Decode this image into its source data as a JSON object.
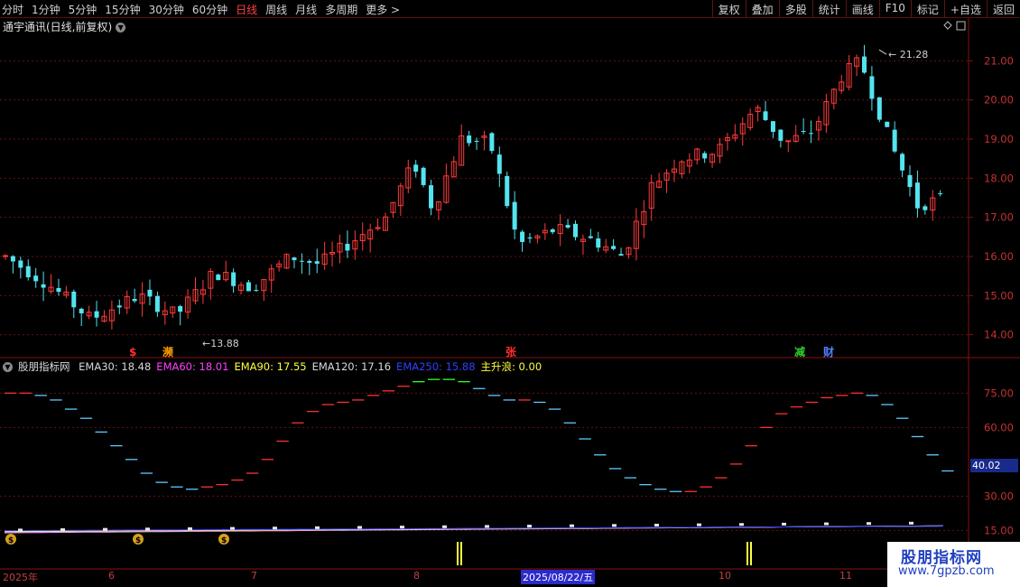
{
  "toolbar": {
    "periods": [
      "分时",
      "1分钟",
      "5分钟",
      "15分钟",
      "30分钟",
      "60分钟",
      "日线",
      "周线",
      "月线",
      "多周期",
      "更多 >"
    ],
    "active_period": "日线",
    "actions": [
      "复权",
      "叠加",
      "多股",
      "统计",
      "画线",
      "F10",
      "标记",
      "+自选",
      "返回"
    ]
  },
  "stock": {
    "title": "通宇通讯(日线,前复权)"
  },
  "price_axis": {
    "ticks": [
      "21.00",
      "20.00",
      "19.00",
      "18.00",
      "17.00",
      "16.00",
      "15.00",
      "14.00"
    ]
  },
  "annotations": {
    "high": "21.28",
    "low": "13.88"
  },
  "badges": [
    {
      "text": "$",
      "color": "#ff3030"
    },
    {
      "text": "濒",
      "color": "#ffa000"
    },
    {
      "text": "张",
      "color": "#ff3030"
    },
    {
      "text": "减",
      "color": "#30d030"
    },
    {
      "text": "财",
      "color": "#5080ff"
    }
  ],
  "indicator": {
    "name": "股朋指标网",
    "items": [
      {
        "label": "EMA30: 18.48",
        "color": "#d8d8d8"
      },
      {
        "label": "EMA60: 18.01",
        "color": "#ff40ff"
      },
      {
        "label": "EMA90: 17.55",
        "color": "#ffff40"
      },
      {
        "label": "EMA120: 17.16",
        "color": "#d8d8d8"
      },
      {
        "label": "EMA250: 15.88",
        "color": "#3040ff"
      },
      {
        "label": "主升浪: 0.00",
        "color": "#ffff40"
      }
    ],
    "axis_ticks": [
      "75.00",
      "60.00",
      "30.00",
      "15.00"
    ],
    "current_value": "40.02"
  },
  "date_axis": {
    "labels": [
      "2025年",
      "6",
      "7",
      "8",
      "10",
      "11"
    ],
    "selected": "2025/08/22/五"
  },
  "watermark": {
    "line1": "股朋指标网",
    "line2": "www.7gpzb.com"
  },
  "chart_data": {
    "type": "candlestick",
    "title": "通宇通讯(日线,前复权)",
    "price_range": [
      13.6,
      21.7
    ],
    "high": 21.28,
    "low": 13.88,
    "indicator_range": [
      10,
      85
    ],
    "indicator_values": [
      75,
      75,
      74,
      72,
      68,
      64,
      58,
      52,
      46,
      40,
      36,
      34,
      33,
      34,
      35,
      37,
      40,
      46,
      54,
      62,
      67,
      70,
      71,
      72,
      74,
      76,
      78,
      80,
      81,
      81,
      80,
      77,
      74,
      72,
      72,
      71,
      68,
      62,
      55,
      48,
      42,
      38,
      35,
      33,
      32,
      32,
      34,
      38,
      44,
      52,
      60,
      66,
      69,
      71,
      73,
      74,
      75,
      74,
      70,
      64,
      56,
      48,
      41
    ],
    "series_meta": [
      {
        "name": "EMA30",
        "color": "#d8d8d8"
      },
      {
        "name": "EMA60",
        "color": "#ff40ff"
      },
      {
        "name": "EMA90",
        "color": "#ffff40"
      },
      {
        "name": "EMA120",
        "color": "#d8d8d8"
      },
      {
        "name": "EMA250",
        "color": "#3040ff"
      }
    ]
  }
}
